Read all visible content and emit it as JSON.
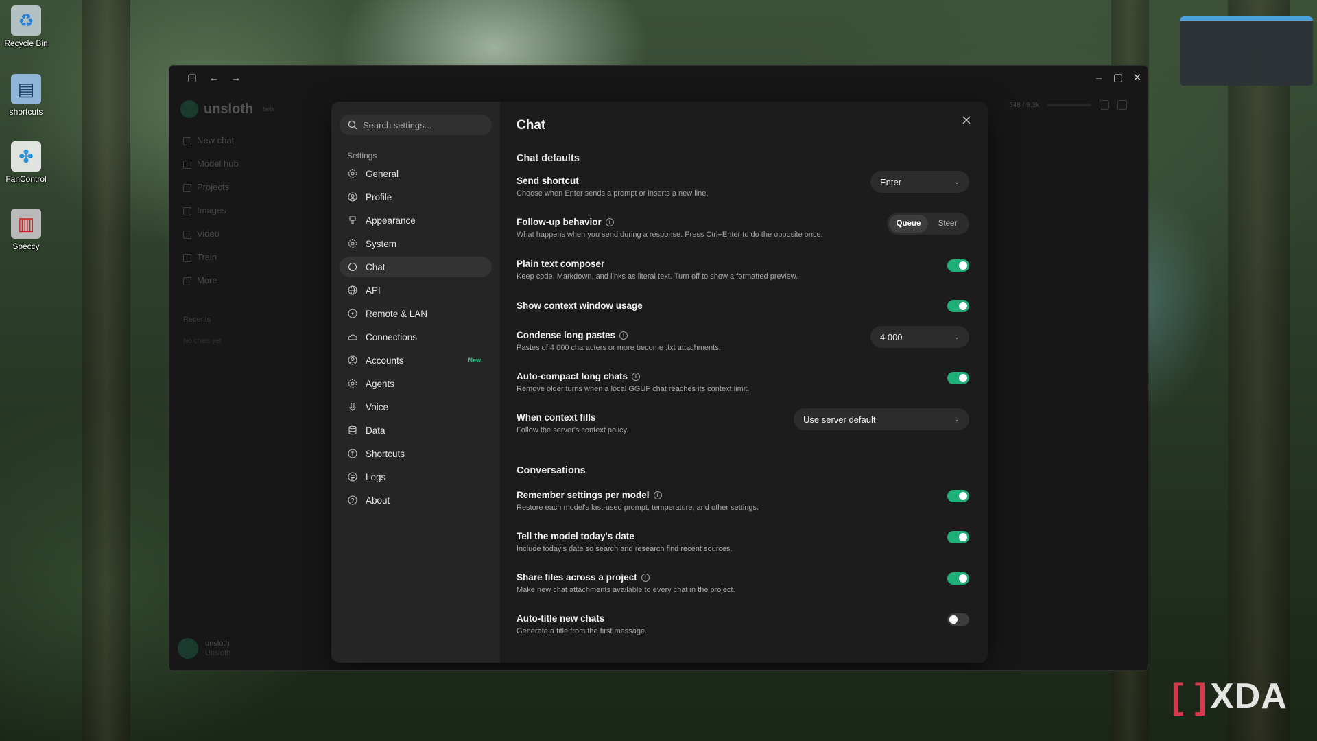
{
  "desktop": {
    "icons": [
      {
        "label": "Recycle Bin",
        "icon": "recycle-bin-icon"
      },
      {
        "label": "shortcuts",
        "icon": "folder-icon"
      },
      {
        "label": "FanControl",
        "icon": "fan-icon"
      },
      {
        "label": "Speccy",
        "icon": "speccy-icon"
      }
    ],
    "watermark": "XDA"
  },
  "background_app": {
    "logo": "unsloth",
    "version": "beta",
    "nav": [
      "New chat",
      "Model hub",
      "Projects",
      "Images",
      "Video",
      "Train",
      "More"
    ],
    "recents_label": "Recents",
    "no_chats": "No chats yet",
    "user_name": "unsloth",
    "user_sub": "Unsloth",
    "context_counter": "548 / 9.3k"
  },
  "settings": {
    "search_placeholder": "Search settings...",
    "heading": "Settings",
    "nav": [
      {
        "label": "General",
        "icon": "gear-icon"
      },
      {
        "label": "Profile",
        "icon": "user-circle-icon"
      },
      {
        "label": "Appearance",
        "icon": "brush-icon"
      },
      {
        "label": "System",
        "icon": "cog-icon"
      },
      {
        "label": "Chat",
        "icon": "chat-bubble-icon",
        "active": true
      },
      {
        "label": "API",
        "icon": "globe-icon"
      },
      {
        "label": "Remote & LAN",
        "icon": "remote-icon"
      },
      {
        "label": "Connections",
        "icon": "cloud-icon"
      },
      {
        "label": "Accounts",
        "icon": "account-icon",
        "badge": "New"
      },
      {
        "label": "Agents",
        "icon": "agent-icon"
      },
      {
        "label": "Voice",
        "icon": "microphone-icon"
      },
      {
        "label": "Data",
        "icon": "database-icon"
      },
      {
        "label": "Shortcuts",
        "icon": "shortcut-icon"
      },
      {
        "label": "Logs",
        "icon": "logs-icon"
      },
      {
        "label": "About",
        "icon": "help-circle-icon"
      }
    ]
  },
  "chat": {
    "title": "Chat",
    "chat_defaults": "Chat defaults",
    "send_shortcut": {
      "title": "Send shortcut",
      "desc": "Choose when Enter sends a prompt or inserts a new line.",
      "value": "Enter"
    },
    "follow_up": {
      "title": "Follow-up behavior",
      "desc": "What happens when you send during a response. Press Ctrl+Enter to do the opposite once.",
      "options": [
        "Queue",
        "Steer"
      ],
      "selected": "Queue"
    },
    "plain_text": {
      "title": "Plain text composer",
      "desc": "Keep code, Markdown, and links as literal text. Turn off to show a formatted preview.",
      "on": true
    },
    "context_usage": {
      "title": "Show context window usage",
      "on": true
    },
    "condense": {
      "title": "Condense long pastes",
      "desc": "Pastes of 4 000 characters or more become .txt attachments.",
      "value": "4 000"
    },
    "auto_compact": {
      "title": "Auto-compact long chats",
      "desc": "Remove older turns when a local GGUF chat reaches its context limit.",
      "on": true
    },
    "context_fills": {
      "title": "When context fills",
      "desc": "Follow the server's context policy.",
      "value": "Use server default"
    },
    "conversations": "Conversations",
    "remember": {
      "title": "Remember settings per model",
      "desc": "Restore each model's last-used prompt, temperature, and other settings.",
      "on": true
    },
    "today_date": {
      "title": "Tell the model today's date",
      "desc": "Include today's date so search and research find recent sources.",
      "on": true
    },
    "share_files": {
      "title": "Share files across a project",
      "desc": "Make new chat attachments available to every chat in the project.",
      "on": true
    },
    "auto_title": {
      "title": "Auto-title new chats",
      "desc": "Generate a title from the first message.",
      "on": false
    }
  },
  "colors": {
    "accent": "#1fb079",
    "badge": "#2cc88a",
    "panel": "#1c1c1c",
    "sidebar": "#252525"
  }
}
